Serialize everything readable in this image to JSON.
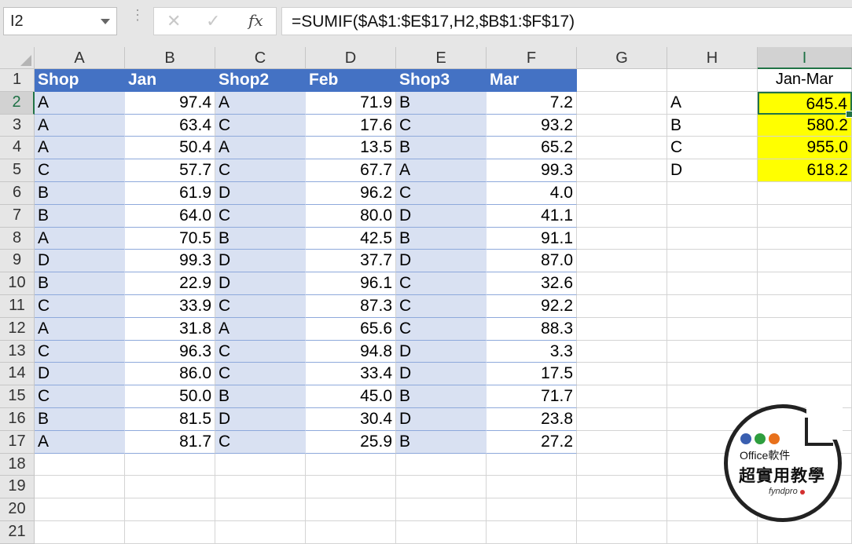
{
  "formula_bar": {
    "name_box": "I2",
    "cancel_glyph": "✕",
    "enter_glyph": "✓",
    "fx_glyph": "fx",
    "formula": "=SUMIF($A$1:$E$17,H2,$B$1:$F$17)"
  },
  "columns": [
    "A",
    "B",
    "C",
    "D",
    "E",
    "F",
    "G",
    "H",
    "I"
  ],
  "header_row": [
    "Shop",
    "Jan",
    "Shop2",
    "Feb",
    "Shop3",
    "Mar"
  ],
  "rows": [
    [
      "A",
      "97.4",
      "A",
      "71.9",
      "B",
      "7.2"
    ],
    [
      "A",
      "63.4",
      "C",
      "17.6",
      "C",
      "93.2"
    ],
    [
      "A",
      "50.4",
      "A",
      "13.5",
      "B",
      "65.2"
    ],
    [
      "C",
      "57.7",
      "C",
      "67.7",
      "A",
      "99.3"
    ],
    [
      "B",
      "61.9",
      "D",
      "96.2",
      "C",
      "4.0"
    ],
    [
      "B",
      "64.0",
      "C",
      "80.0",
      "D",
      "41.1"
    ],
    [
      "A",
      "70.5",
      "B",
      "42.5",
      "B",
      "91.1"
    ],
    [
      "D",
      "99.3",
      "D",
      "37.7",
      "D",
      "87.0"
    ],
    [
      "B",
      "22.9",
      "D",
      "96.1",
      "C",
      "32.6"
    ],
    [
      "C",
      "33.9",
      "C",
      "87.3",
      "C",
      "92.2"
    ],
    [
      "A",
      "31.8",
      "A",
      "65.6",
      "C",
      "88.3"
    ],
    [
      "C",
      "96.3",
      "C",
      "94.8",
      "D",
      "3.3"
    ],
    [
      "D",
      "86.0",
      "C",
      "33.4",
      "D",
      "17.5"
    ],
    [
      "C",
      "50.0",
      "B",
      "45.0",
      "B",
      "71.7"
    ],
    [
      "B",
      "81.5",
      "D",
      "30.4",
      "D",
      "23.8"
    ],
    [
      "A",
      "81.7",
      "C",
      "25.9",
      "B",
      "27.2"
    ]
  ],
  "row_numbers": [
    "1",
    "2",
    "3",
    "4",
    "5",
    "6",
    "7",
    "8",
    "9",
    "10",
    "11",
    "12",
    "13",
    "14",
    "15",
    "16",
    "17",
    "18",
    "19",
    "20",
    "21"
  ],
  "summary": {
    "header": "Jan-Mar",
    "items": [
      {
        "shop": "A",
        "total": "645.4"
      },
      {
        "shop": "B",
        "total": "580.2"
      },
      {
        "shop": "C",
        "total": "955.0"
      },
      {
        "shop": "D",
        "total": "618.2"
      }
    ]
  },
  "watermark": {
    "line1": "Office軟件",
    "line2": "超實用教學",
    "line3": "fyndpro"
  },
  "colors": {
    "header_fill": "#4472c4",
    "band_fill": "#d9e1f2",
    "highlight_fill": "#ffff00",
    "selection_border": "#217346"
  }
}
